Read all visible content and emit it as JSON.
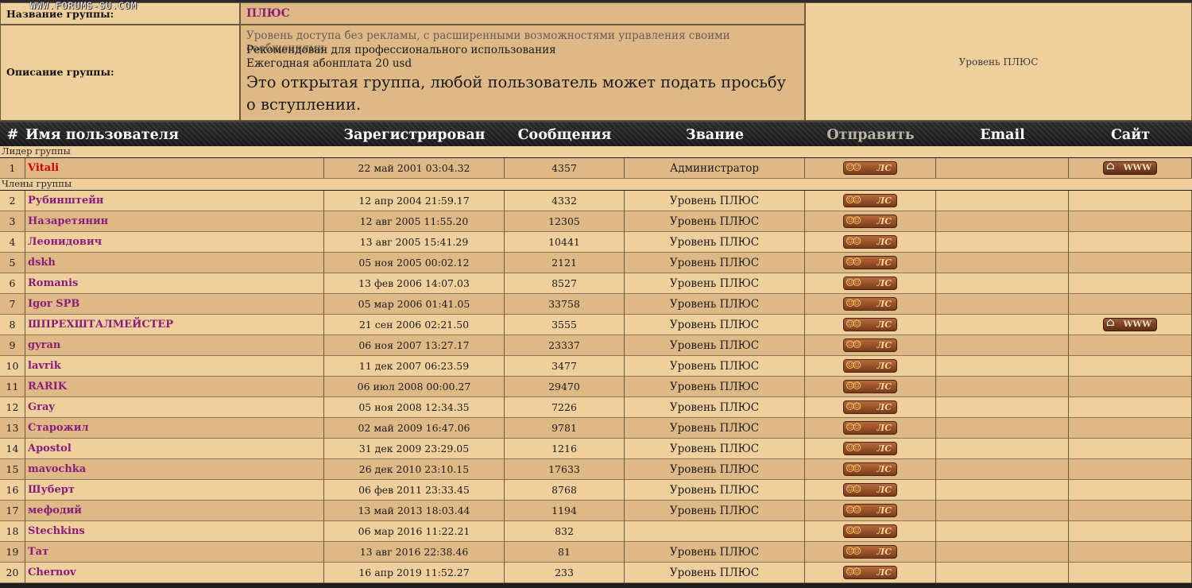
{
  "watermark": "WWW.FORUMS-SU.COM",
  "group": {
    "name_label": "Название группы:",
    "name": "ПЛЮС",
    "desc_label": "Описание группы:",
    "desc_line1": "Уровень доступа без рекламы, с расширенными возможностями управления своими сообщениями",
    "desc_line2": "Рекомендован для профессионального использования",
    "desc_line3": "Ежегодная абонплата 20 usd",
    "desc_big": "Это открытая группа, любой пользователь может подать просьбу о вступлении.",
    "level_text": "Уровень ПЛЮС"
  },
  "table": {
    "headers": {
      "num": "#",
      "user": "Имя пользователя",
      "registered": "Зарегистрирован",
      "posts": "Сообщения",
      "rank": "Звание",
      "send": "Отправить",
      "email": "Email",
      "site": "Сайт"
    },
    "section_leader": "Лидер группы",
    "section_members": "Члены группы",
    "pm_label": "ЛС",
    "www_label": "WWW",
    "leader": {
      "n": "1",
      "name": "Vitali",
      "reg": "22 май 2001 03:04.32",
      "posts": "4357",
      "rank": "Администратор"
    },
    "members": [
      {
        "n": "2",
        "name": "Рубинштейн",
        "reg": "12 апр 2004 21:59.17",
        "posts": "4332",
        "rank": "Уровень ПЛЮС"
      },
      {
        "n": "3",
        "name": "Назаретянин",
        "reg": "12 авг 2005 11:55.20",
        "posts": "12305",
        "rank": "Уровень ПЛЮС"
      },
      {
        "n": "4",
        "name": "Леонидович",
        "reg": "13 авг 2005 15:41.29",
        "posts": "10441",
        "rank": "Уровень ПЛЮС"
      },
      {
        "n": "5",
        "name": "dskh",
        "reg": "05 ноя 2005 00:02.12",
        "posts": "2121",
        "rank": "Уровень ПЛЮС"
      },
      {
        "n": "6",
        "name": "Romanis",
        "reg": "13 фев 2006 14:07.03",
        "posts": "8527",
        "rank": "Уровень ПЛЮС"
      },
      {
        "n": "7",
        "name": "Igor SPB",
        "reg": "05 мар 2006 01:41.05",
        "posts": "33758",
        "rank": "Уровень ПЛЮС"
      },
      {
        "n": "8",
        "name": "ШПРЕХШТАЛМЕЙСТЕР",
        "reg": "21 сен 2006 02:21.50",
        "posts": "3555",
        "rank": "Уровень ПЛЮС"
      },
      {
        "n": "9",
        "name": "gyran",
        "reg": "06 ноя 2007 13:27.17",
        "posts": "23337",
        "rank": "Уровень ПЛЮС"
      },
      {
        "n": "10",
        "name": "lavrik",
        "reg": "11 дек 2007 06:23.59",
        "posts": "3477",
        "rank": "Уровень ПЛЮС"
      },
      {
        "n": "11",
        "name": "RARIK",
        "reg": "06 июл 2008 00:00.27",
        "posts": "29470",
        "rank": "Уровень ПЛЮС"
      },
      {
        "n": "12",
        "name": "Gray",
        "reg": "05 ноя 2008 12:34.35",
        "posts": "7226",
        "rank": "Уровень ПЛЮС"
      },
      {
        "n": "13",
        "name": "Старожил",
        "reg": "02 май 2009 16:47.06",
        "posts": "9781",
        "rank": "Уровень ПЛЮС"
      },
      {
        "n": "14",
        "name": "Apostol",
        "reg": "31 дек 2009 23:29.05",
        "posts": "1216",
        "rank": "Уровень ПЛЮС"
      },
      {
        "n": "15",
        "name": "mavochka",
        "reg": "26 дек 2010 23:10.15",
        "posts": "17633",
        "rank": "Уровень ПЛЮС"
      },
      {
        "n": "16",
        "name": "Шуберт",
        "reg": "06 фев 2011 23:33.45",
        "posts": "8768",
        "rank": "Уровень ПЛЮС"
      },
      {
        "n": "17",
        "name": "мефодий",
        "reg": "13 май 2013 18:03.44",
        "posts": "1194",
        "rank": "Уровень ПЛЮС"
      },
      {
        "n": "18",
        "name": "Stechkins",
        "reg": "06 мар 2016 11:22.21",
        "posts": "832",
        "rank": ""
      },
      {
        "n": "19",
        "name": "Тат",
        "reg": "13 авг 2016 22:38.46",
        "posts": "81",
        "rank": "Уровень ПЛЮС"
      },
      {
        "n": "20",
        "name": "Chernov",
        "reg": "16 апр 2019 11:52.27",
        "posts": "233",
        "rank": "Уровень ПЛЮС"
      }
    ],
    "site_rows": [
      "1",
      "8"
    ]
  },
  "colors": {
    "row_light": "#efd09c",
    "row_dark": "#dfb985",
    "name": "#8a1c7c",
    "leader_name": "#d10000"
  }
}
